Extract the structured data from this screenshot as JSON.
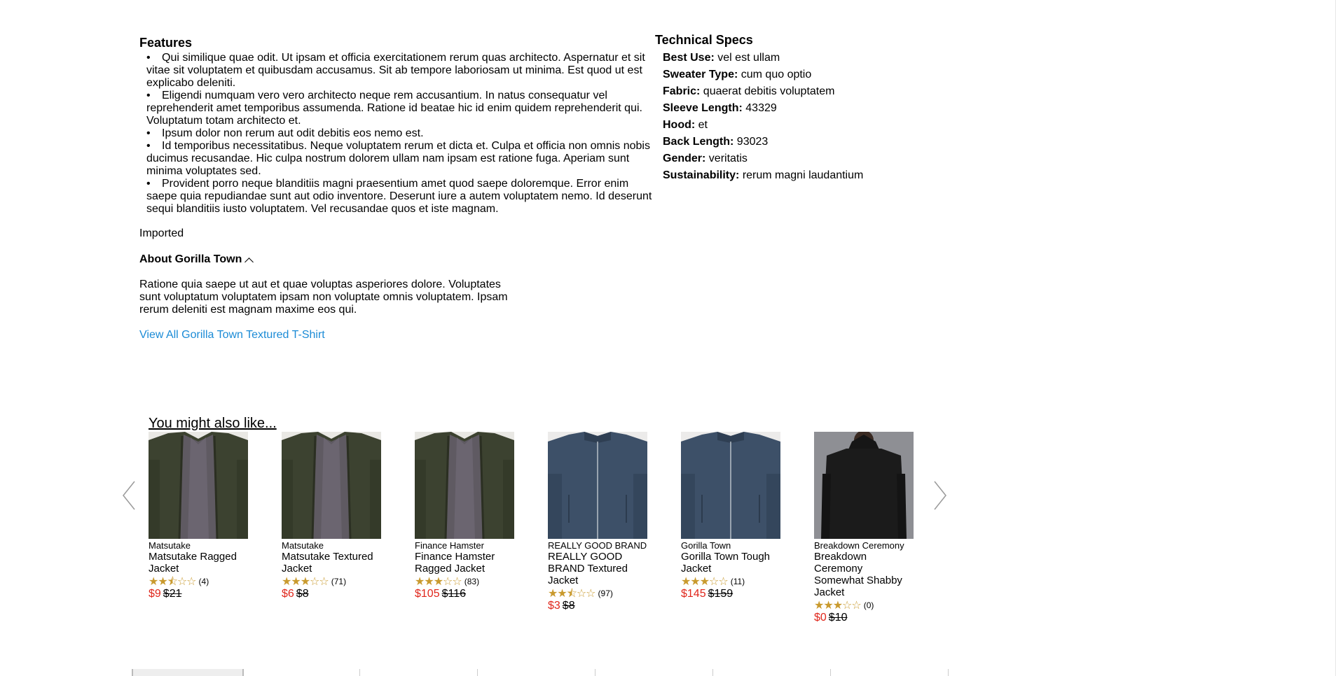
{
  "features": {
    "title": "Features",
    "items": [
      "Qui similique quae odit. Ut ipsam et officia exercitationem rerum quas architecto. Aspernatur et sit vitae sit voluptatem et quibusdam accusamus. Sit ab tempore laboriosam ut minima. Est quod ut est explicabo deleniti.",
      "Eligendi numquam vero vero architecto neque rem accusantium. In natus consequatur vel reprehenderit amet temporibus assumenda. Ratione id beatae hic id enim quidem reprehenderit qui. Voluptatum totam architecto et.",
      "Ipsum dolor non rerum aut odit debitis eos nemo est.",
      "Id temporibus necessitatibus. Neque voluptatem rerum et dicta et. Culpa et officia non omnis nobis ducimus recusandae. Hic culpa nostrum dolorem ullam nam ipsam est ratione fuga. Aperiam sunt minima voluptates sed.",
      "Provident porro neque blanditiis magni praesentium amet quod saepe doloremque. Error enim saepe quia repudiandae sunt aut odio inventore. Deserunt iure a autem voluptatem nemo. Id deserunt sequi blanditiis iusto voluptatem. Vel recusandae quos et iste magnam."
    ],
    "bullet": "•",
    "imported": "Imported"
  },
  "about": {
    "title": "About Gorilla Town",
    "text": "Ratione quia saepe ut aut et quae voluptas asperiores dolore. Voluptates sunt voluptatum voluptatem ipsam non voluptate omnis voluptatem. Ipsam rerum deleniti est magnam maxime eos qui.",
    "view_all": "View All Gorilla Town Textured T-Shirt"
  },
  "specs": {
    "title": "Technical Specs",
    "rows": [
      {
        "key": "Best Use:",
        "value": "vel est ullam"
      },
      {
        "key": "Sweater Type:",
        "value": "cum quo optio"
      },
      {
        "key": "Fabric:",
        "value": "quaerat debitis voluptatem"
      },
      {
        "key": "Sleeve Length:",
        "value": "43329"
      },
      {
        "key": "Hood:",
        "value": "et"
      },
      {
        "key": "Back Length:",
        "value": "93023"
      },
      {
        "key": "Gender:",
        "value": "veritatis"
      },
      {
        "key": "Sustainability:",
        "value": "rerum magni laudantium"
      }
    ]
  },
  "recommendations": {
    "title": "You might also like...",
    "prev_icon": "chevron-left-icon",
    "next_icon": "chevron-right-icon",
    "products": [
      {
        "brand": "Matsutake",
        "name": "Matsutake Ragged Jacket",
        "rating": 2.5,
        "count": "(4)",
        "sale": "$9",
        "orig": "$21",
        "image": "olive-bomber-jacket"
      },
      {
        "brand": "Matsutake",
        "name": "Matsutake Textured Jacket",
        "rating": 3,
        "count": "(71)",
        "sale": "$6",
        "orig": "$8",
        "image": "olive-bomber-jacket"
      },
      {
        "brand": "Finance Hamster",
        "name": "Finance Hamster Ragged Jacket",
        "rating": 3,
        "count": "(83)",
        "sale": "$105",
        "orig": "$116",
        "image": "olive-bomber-jacket"
      },
      {
        "brand": "REALLY GOOD BRAND",
        "name": "REALLY GOOD BRAND Textured Jacket",
        "rating": 2.5,
        "count": "(97)",
        "sale": "$3",
        "orig": "$8",
        "image": "navy-zip-jacket"
      },
      {
        "brand": "Gorilla Town",
        "name": "Gorilla Town Tough Jacket",
        "rating": 3,
        "count": "(11)",
        "sale": "$145",
        "orig": "$159",
        "image": "navy-zip-jacket"
      },
      {
        "brand": "Breakdown Ceremony",
        "name": "Breakdown Ceremony Somewhat Shabby Jacket",
        "rating": 3,
        "count": "(0)",
        "sale": "$0",
        "orig": "$10",
        "image": "black-hoodie-back"
      }
    ]
  },
  "colors": {
    "link": "#1b8bd6",
    "sale_price": "#e0261b",
    "star": "#c99a2e"
  }
}
